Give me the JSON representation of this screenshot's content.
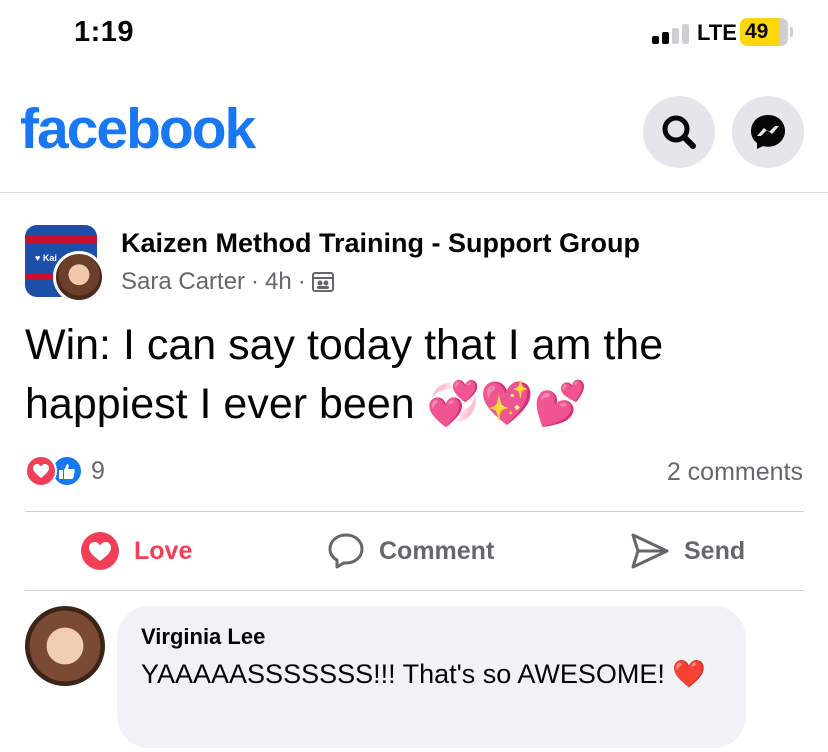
{
  "status_bar": {
    "time": "1:19",
    "network": "LTE",
    "battery": "49"
  },
  "header": {
    "logo": "facebook",
    "search_icon": "search-icon",
    "messenger_icon": "messenger-icon"
  },
  "post": {
    "group_name": "Kaizen Method Training - Support Group",
    "author": "Sara Carter",
    "time": "4h",
    "dot": "·",
    "text": "Win: I can say today that I am the happiest I ever been 💞💖💕",
    "reaction_count": "9",
    "comments_count": "2 comments"
  },
  "actions": {
    "love": "Love",
    "comment": "Comment",
    "send": "Send"
  },
  "comment": {
    "author": "Virginia Lee",
    "text": "YAAAAASSSSSSS!!!  That's so AWESOME! ❤️"
  },
  "colors": {
    "brand": "#1877f2",
    "love": "#f33e58",
    "secondary_text": "#65676b",
    "bubble": "#f0f2f5"
  }
}
